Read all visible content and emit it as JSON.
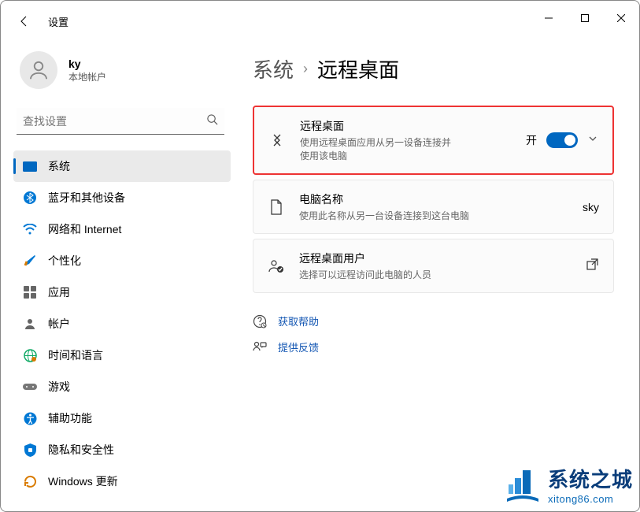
{
  "app_title": "设置",
  "user": {
    "name": "ky",
    "type": "本地帐户"
  },
  "search": {
    "placeholder": "查找设置"
  },
  "nav": [
    {
      "label": "系统"
    },
    {
      "label": "蓝牙和其他设备"
    },
    {
      "label": "网络和 Internet"
    },
    {
      "label": "个性化"
    },
    {
      "label": "应用"
    },
    {
      "label": "帐户"
    },
    {
      "label": "时间和语言"
    },
    {
      "label": "游戏"
    },
    {
      "label": "辅助功能"
    },
    {
      "label": "隐私和安全性"
    },
    {
      "label": "Windows 更新"
    }
  ],
  "breadcrumb": {
    "parent": "系统",
    "current": "远程桌面"
  },
  "cards": {
    "remote": {
      "title": "远程桌面",
      "desc": "使用远程桌面应用从另一设备连接并使用该电脑",
      "state_label": "开"
    },
    "pcname": {
      "title": "电脑名称",
      "desc": "使用此名称从另一台设备连接到这台电脑",
      "value": "sky"
    },
    "users": {
      "title": "远程桌面用户",
      "desc": "选择可以远程访问此电脑的人员"
    }
  },
  "links": {
    "help": "获取帮助",
    "feedback": "提供反馈"
  },
  "watermark": {
    "line1": "系统之城",
    "line2": "xitong86.com"
  }
}
